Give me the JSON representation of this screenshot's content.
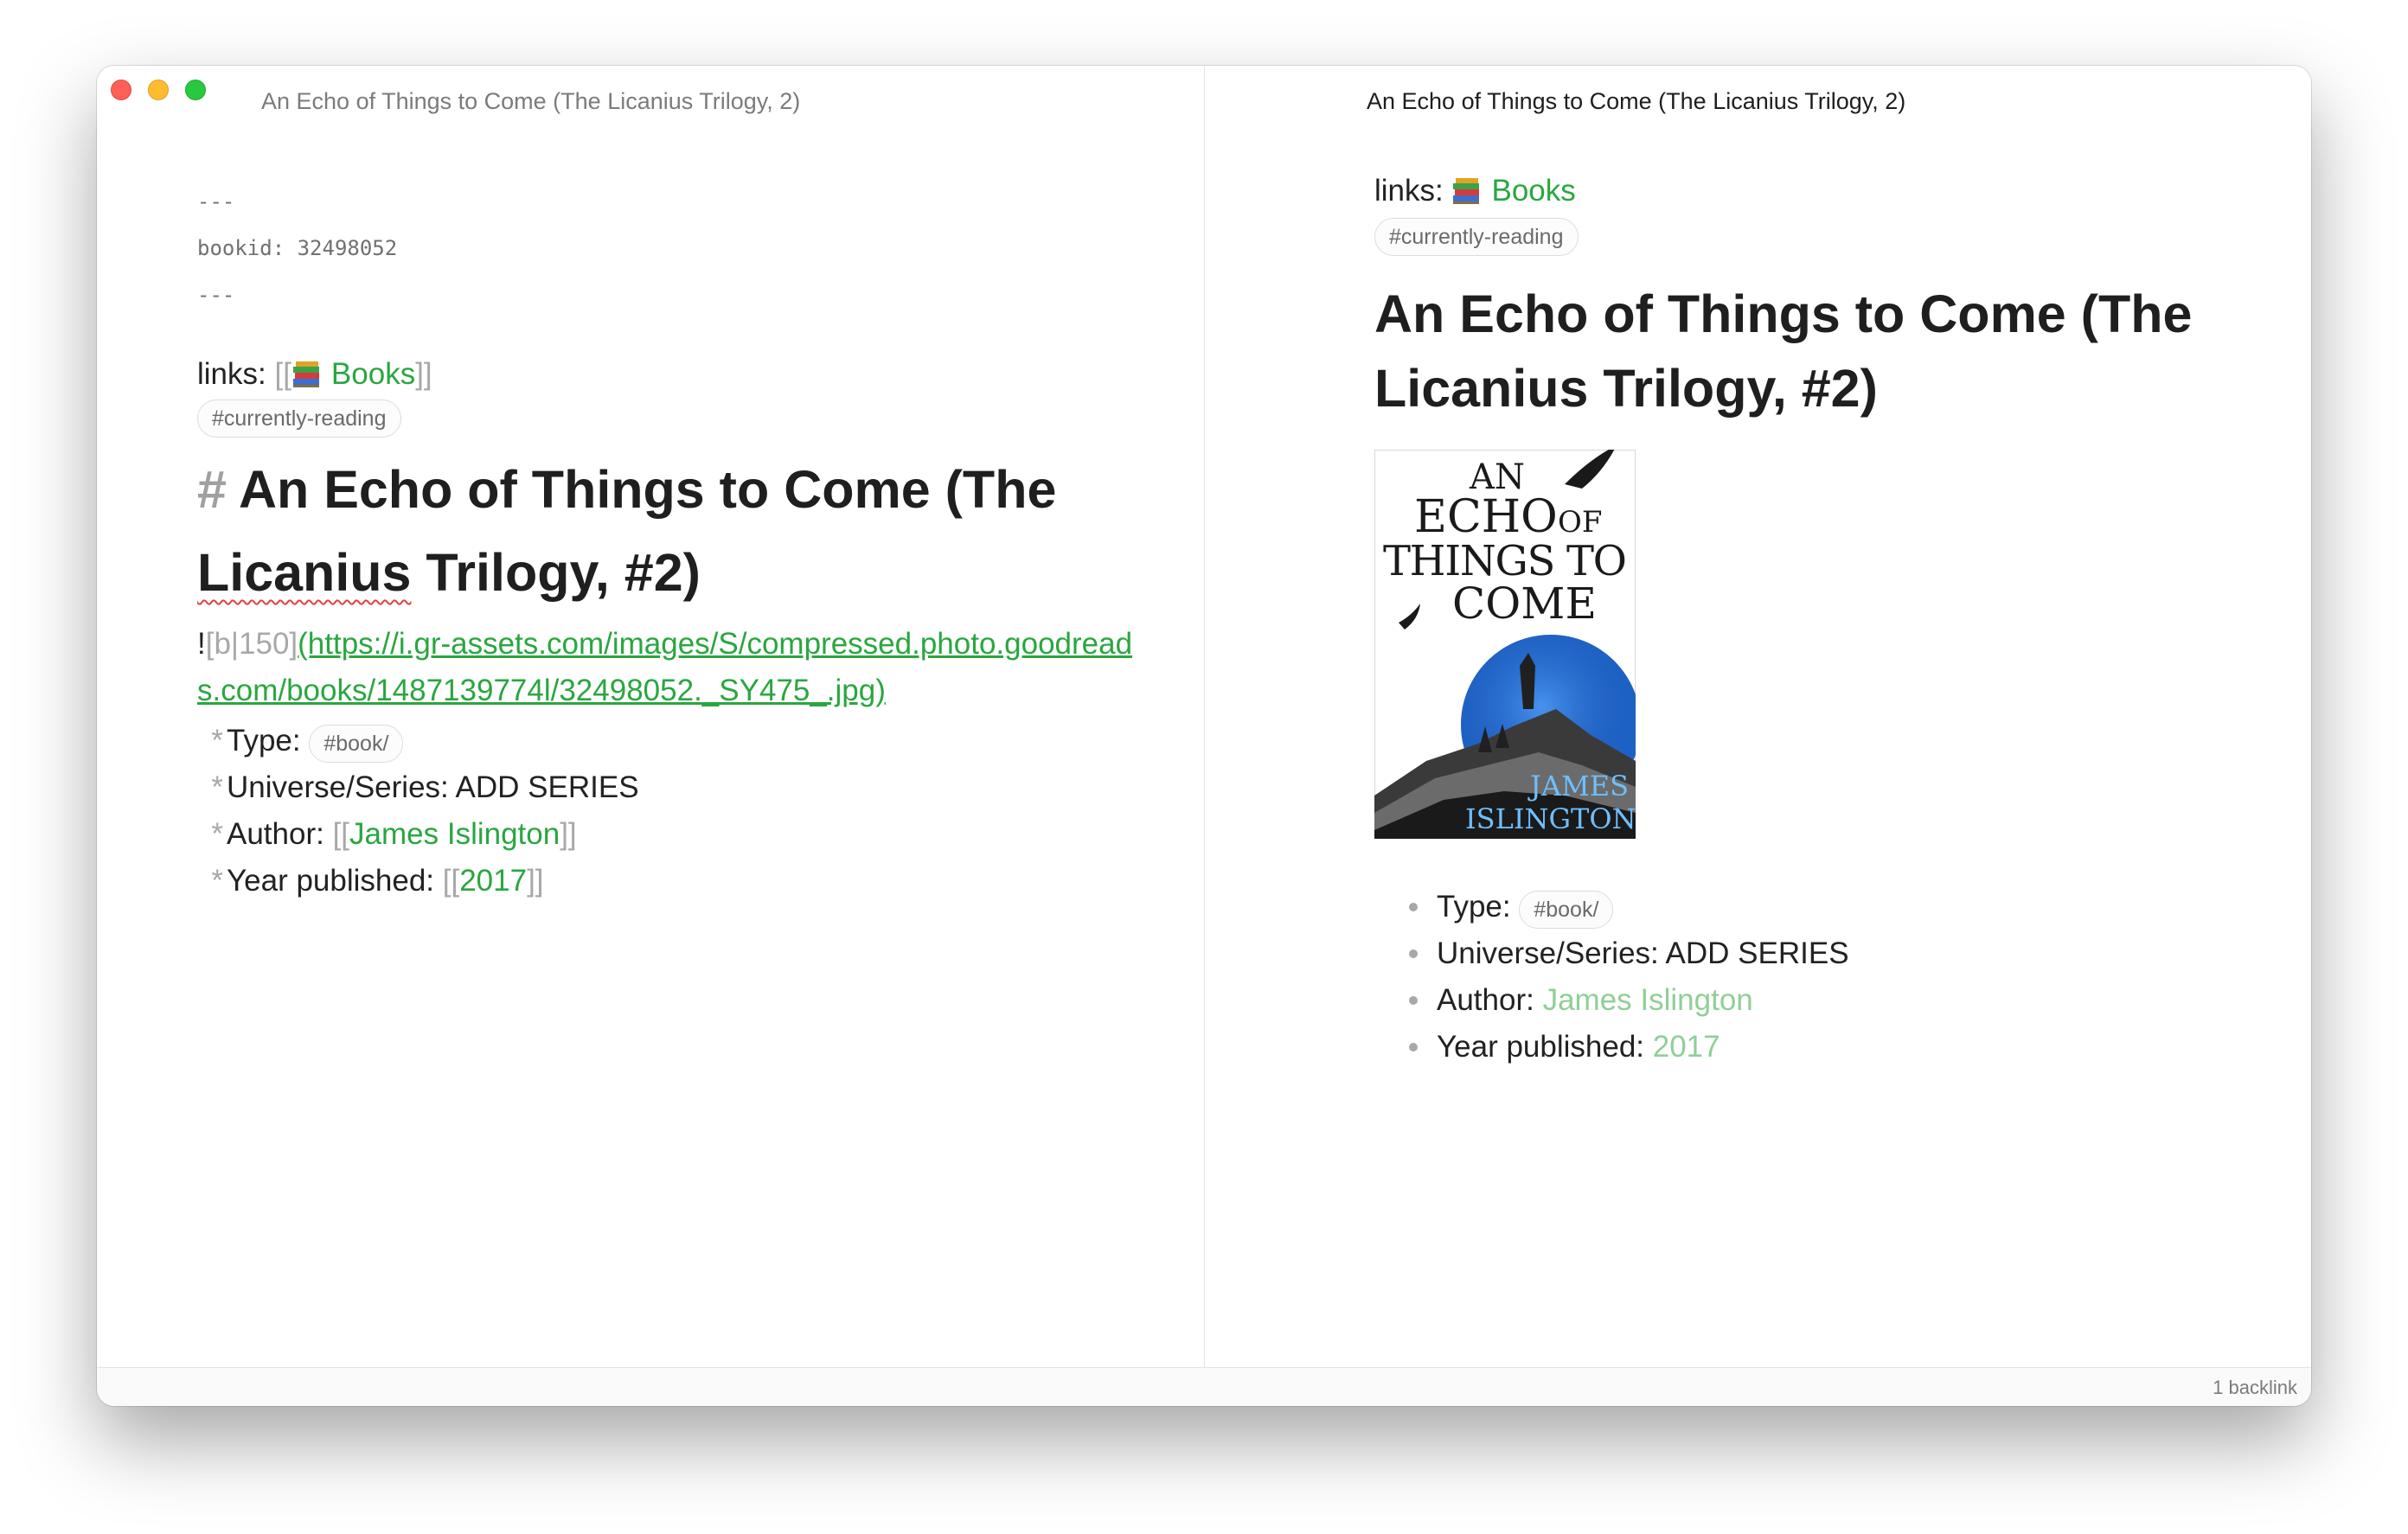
{
  "window": {
    "title": "An Echo of Things to Come (The Licanius Trilogy, 2)"
  },
  "editor": {
    "frontmatter": {
      "delimiter": "---",
      "bookid_line": "bookid: 32498052"
    },
    "links_prefix": "links: ",
    "links_open": "[[",
    "links_label": "Books",
    "links_close": "]]",
    "tag": "#currently-reading",
    "heading_hash": "#",
    "heading_word1": "An Echo of Things to Come (The",
    "heading_word2": "Licanius",
    "heading_word3": " Trilogy, #2)",
    "image_prefix": "!",
    "image_alt": "[b|150]",
    "image_url": "(https://i.gr-assets.com/images/S/compressed.photo.goodreads.com/books/1487139774l/32498052._SY475_.jpg)",
    "list": {
      "bullet": "*",
      "type_label": "Type: ",
      "type_tag": "#book/",
      "series_text": "Universe/Series: ADD SERIES",
      "author_label": "Author: ",
      "author_open": "[[",
      "author_value": "James Islington",
      "author_close": "]]",
      "year_label": "Year published: ",
      "year_open": "[[",
      "year_value": "2017",
      "year_close": "]]"
    }
  },
  "preview": {
    "links_prefix": "links: ",
    "links_label": "Books",
    "tag": "#currently-reading",
    "heading": "An Echo of Things to Come (The Licanius Trilogy, #2)",
    "cover": {
      "line1": "AN",
      "line2": "ECHO",
      "line2b": "OF",
      "line3": "THINGS TO",
      "line4": "COME",
      "author1": "JAMES",
      "author2": "ISLINGTON"
    },
    "list": {
      "type_label": "Type: ",
      "type_tag": "#book/",
      "series_text": "Universe/Series: ADD SERIES",
      "author_label": "Author: ",
      "author_value": "James Islington",
      "year_label": "Year published: ",
      "year_value": "2017"
    }
  },
  "status": {
    "backlinks": "1 backlink"
  },
  "colors": {
    "link_green": "#2aa640",
    "preview_link_green": "#8fcf97",
    "traffic_red": "#fe5f57",
    "traffic_yellow": "#febc2e",
    "traffic_green": "#28c840"
  },
  "icons": {
    "books_emoji": "books-icon"
  }
}
